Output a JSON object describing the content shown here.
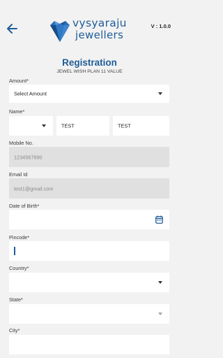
{
  "header": {
    "brand_line1": "vysyaraju",
    "brand_line2": "jewellers",
    "version": "V : 1.0.0",
    "brand_color": "#1f5c98"
  },
  "form": {
    "title": "Registration",
    "subtitle": "JEWEL WISH PLAN 11 VALUE",
    "amount_label": "Amount*",
    "amount_value": "Select Amount",
    "name_label": "Name*",
    "name_title_value": "",
    "first_name_value": "TEST",
    "last_name_value": "TEST",
    "mobile_label": "Mobile No.",
    "mobile_value": "1234567890",
    "email_label": "Email Id",
    "email_value": "test1@gmail.com",
    "dob_label": "Date of Birth*",
    "dob_value": "",
    "pincode_label": "Pincode*",
    "pincode_value": "",
    "country_label": "Country*",
    "country_value": "",
    "state_label": "State*",
    "state_value": "",
    "city_label": "City*",
    "city_value": ""
  },
  "icons": {
    "back": "arrow-left-icon",
    "logo": "diamond-logo-icon",
    "calendar": "calendar-icon",
    "dropdown": "chevron-down-icon"
  }
}
